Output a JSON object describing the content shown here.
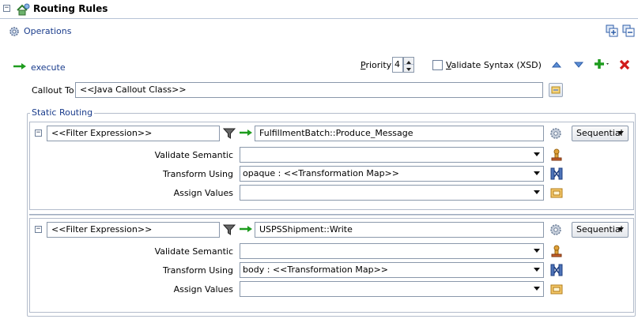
{
  "header": {
    "title": "Routing Rules",
    "collapse_glyph": "−"
  },
  "operations": {
    "label": "Operations"
  },
  "execute": {
    "label": "execute",
    "priority_label": "Priority",
    "priority_value": "4",
    "validate_syntax_label": "Validate Syntax (XSD)",
    "validate_syntax_checked": false
  },
  "callout": {
    "label": "Callout To",
    "value": "<<Java Callout Class>>"
  },
  "static_routing": {
    "legend": "Static Routing",
    "rules": [
      {
        "filter": "<<Filter Expression>>",
        "target": "FulfillmentBatch::Produce_Message",
        "mode": "Sequential",
        "validate_semantic_label": "Validate Semantic",
        "validate_semantic_value": "",
        "transform_label": "Transform Using",
        "transform_value": "opaque : <<Transformation Map>>",
        "assign_label": "Assign Values",
        "assign_value": ""
      },
      {
        "filter": "<<Filter Expression>>",
        "target": "USPSShipment::Write",
        "mode": "Sequential",
        "validate_semantic_label": "Validate Semantic",
        "validate_semantic_value": "",
        "transform_label": "Transform Using",
        "transform_value": "body : <<Transformation Map>>",
        "assign_label": "Assign Values",
        "assign_value": ""
      }
    ]
  },
  "colors": {
    "accent_blue": "#1a3c8c",
    "add_green": "#1e9c1e",
    "delete_red": "#d11a1a"
  }
}
